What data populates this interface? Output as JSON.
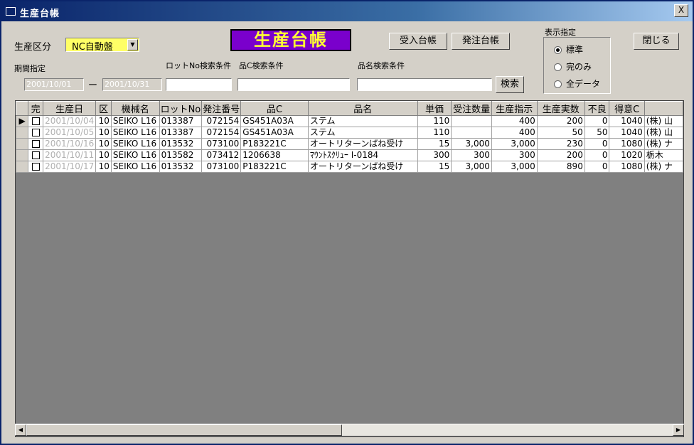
{
  "window": {
    "title": "生産台帳",
    "close_label": "X"
  },
  "header": {
    "category_label": "生産区分",
    "category_value": "NC自動盤",
    "banner": "生産台帳",
    "receipt_ledger_button": "受入台帳",
    "order_ledger_button": "発注台帳",
    "close_button": "閉じる",
    "period_label": "期間指定",
    "date_from": "2001/10/01",
    "date_sep": "ー",
    "date_to": "2001/10/31",
    "lot_search_label": "ロットNo検索条件",
    "item_code_search_label": "品C検索条件",
    "item_name_search_label": "品名検索条件",
    "search_button": "検索",
    "display_label": "表示指定",
    "display_options": [
      "標準",
      "完のみ",
      "全データ"
    ]
  },
  "grid": {
    "columns": [
      "完",
      "生産日",
      "区",
      "機械名",
      "ロットNo",
      "発注番号",
      "品C",
      "品名",
      "単価",
      "受注数量",
      "生産指示",
      "生産実数",
      "不良",
      "得意C",
      ""
    ],
    "rows": [
      {
        "date": "2001/10/04",
        "ku": "10",
        "machine": "SEIKO L16",
        "lot": "013387",
        "order_no": "072154",
        "item_code": "GS451A03A",
        "item_name": "ステム",
        "unit_price": "110",
        "order_qty": "",
        "instruct": "400",
        "actual": "200",
        "defect": "0",
        "customer_code": "1040",
        "customer": "(株) 山"
      },
      {
        "date": "2001/10/05",
        "ku": "10",
        "machine": "SEIKO L16",
        "lot": "013387",
        "order_no": "072154",
        "item_code": "GS451A03A",
        "item_name": "ステム",
        "unit_price": "110",
        "order_qty": "",
        "instruct": "400",
        "actual": "50",
        "defect": "50",
        "customer_code": "1040",
        "customer": "(株) 山"
      },
      {
        "date": "2001/10/16",
        "ku": "10",
        "machine": "SEIKO L16",
        "lot": "013532",
        "order_no": "073100",
        "item_code": "P183221C",
        "item_name": "オートリターンばね受け",
        "unit_price": "15",
        "order_qty": "3,000",
        "instruct": "3,000",
        "actual": "230",
        "defect": "0",
        "customer_code": "1080",
        "customer": "(株) ナ"
      },
      {
        "date": "2001/10/11",
        "ku": "10",
        "machine": "SEIKO L16",
        "lot": "013582",
        "order_no": "073412",
        "item_code": "1206638",
        "item_name": "ﾏｳﾝﾄｽｸﾘｭｰ I-0184",
        "unit_price": "300",
        "order_qty": "300",
        "instruct": "300",
        "actual": "200",
        "defect": "0",
        "customer_code": "1020",
        "customer": "栃木"
      },
      {
        "date": "2001/10/17",
        "ku": "10",
        "machine": "SEIKO L16",
        "lot": "013532",
        "order_no": "073100",
        "item_code": "P183221C",
        "item_name": "オートリターンばね受け",
        "unit_price": "15",
        "order_qty": "3,000",
        "instruct": "3,000",
        "actual": "890",
        "defect": "0",
        "customer_code": "1080",
        "customer": "(株) ナ"
      }
    ]
  }
}
